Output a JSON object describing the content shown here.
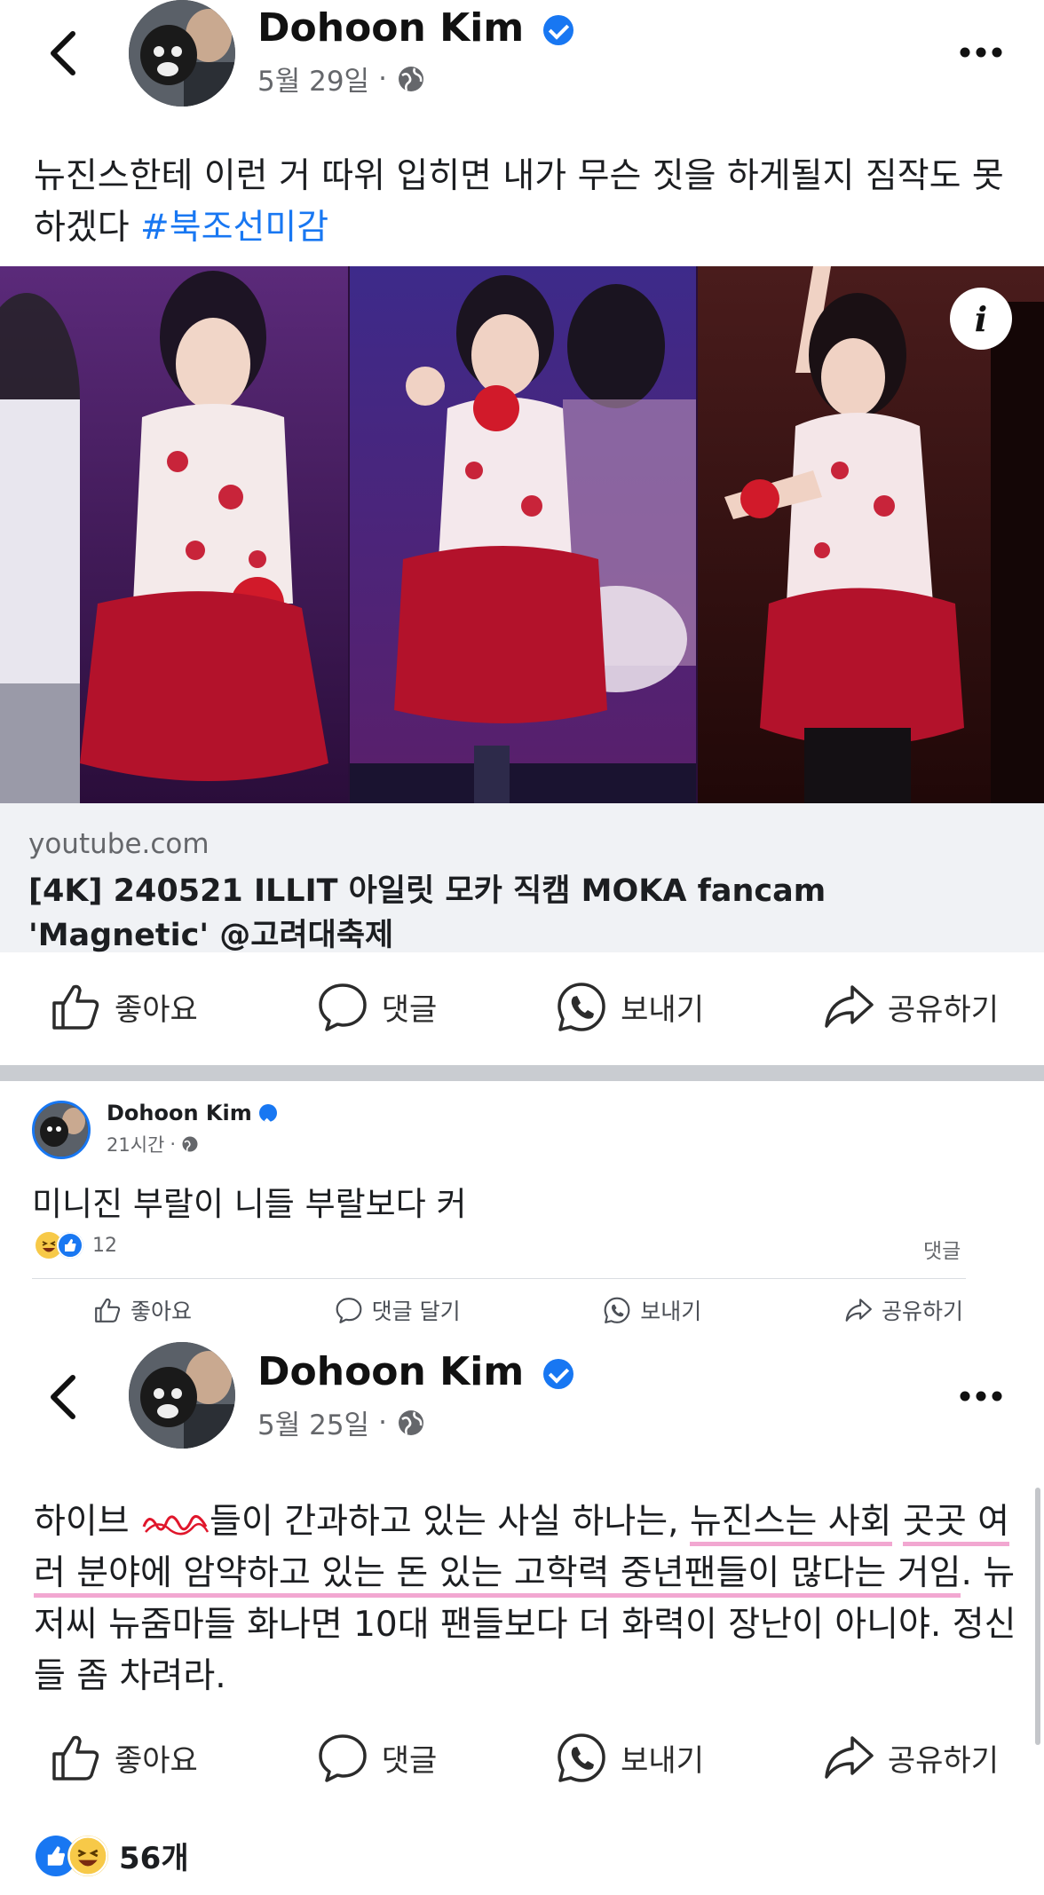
{
  "post1": {
    "author": "Dohoon Kim",
    "date": "5월 29일",
    "dot": "·",
    "text": "뉴진스한테 이런 거 따위 입히면 내가 무슨 짓을 하게될지 짐작도 못하겠다",
    "hashtag": "#북조선미감",
    "link": {
      "domain": "youtube.com",
      "title_line1": "[4K] 240521 ILLIT 아일릿 모카 직캠 MOKA fancam",
      "title_line2": "'Magnetic' @고려대축제",
      "info_glyph": "i"
    },
    "actions": {
      "like": "좋아요",
      "comment": "댓글",
      "send": "보내기",
      "share": "공유하기"
    }
  },
  "post2": {
    "author": "Dohoon Kim",
    "time": "21시간",
    "dot": "·",
    "text": "미니진 부랄이 니들 부랄보다 커",
    "reaction_count": "12",
    "comment_label": "댓글",
    "actions": {
      "like": "좋아요",
      "comment": "댓글 달기",
      "send": "보내기",
      "share": "공유하기"
    }
  },
  "post3": {
    "author": "Dohoon Kim",
    "date": "5월 25일",
    "dot": "·",
    "text_part1": "하이브 ",
    "text_part2": "들이 간과하고 있는 사실 하나는, ",
    "text_hl1": "뉴진스는 사회",
    "text_hl2": "곳곳 여러 분야에 암약하고 있는 돈 있는 고학력 중년팬들이 많다는 거임",
    "text_part3": ". 뉴저씨 뉴줌마들 화나면 10대 팬들보다 더 화력이 장난이 아니야. 정신들 좀 차려라.",
    "reaction_count": "56개",
    "actions": {
      "like": "좋아요",
      "comment": "댓글",
      "send": "보내기",
      "share": "공유하기"
    }
  },
  "colors": {
    "link_blue": "#1877f2",
    "muted": "#65676b",
    "highlight": "#f2a7d1",
    "stage_purple": "#3a1457",
    "dress_red": "#b3122b"
  }
}
